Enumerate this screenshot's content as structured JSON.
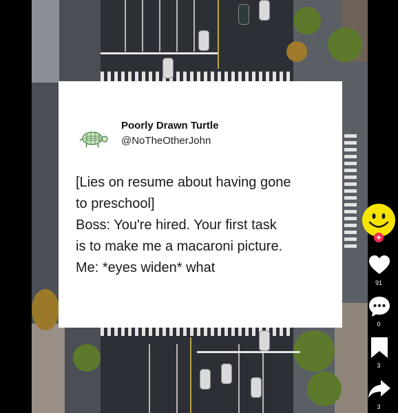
{
  "post": {
    "author_name": "Poorly Drawn Turtle",
    "author_handle": "@NoTheOtherJohn",
    "lines": [
      "[Lies on resume about having gone",
      "to preschool]",
      "Boss: You're hired. Your first task",
      "is to make me a macaroni picture.",
      "Me: *eyes widen* what"
    ]
  },
  "actions": {
    "follow_plus": "+",
    "likes": "91",
    "comments": "0",
    "saves": "3",
    "shares": "3"
  },
  "icons": {
    "avatar": "smiley-face-icon",
    "like": "heart-icon",
    "comment": "comment-bubble-icon",
    "save": "bookmark-icon",
    "share": "share-arrow-icon"
  }
}
